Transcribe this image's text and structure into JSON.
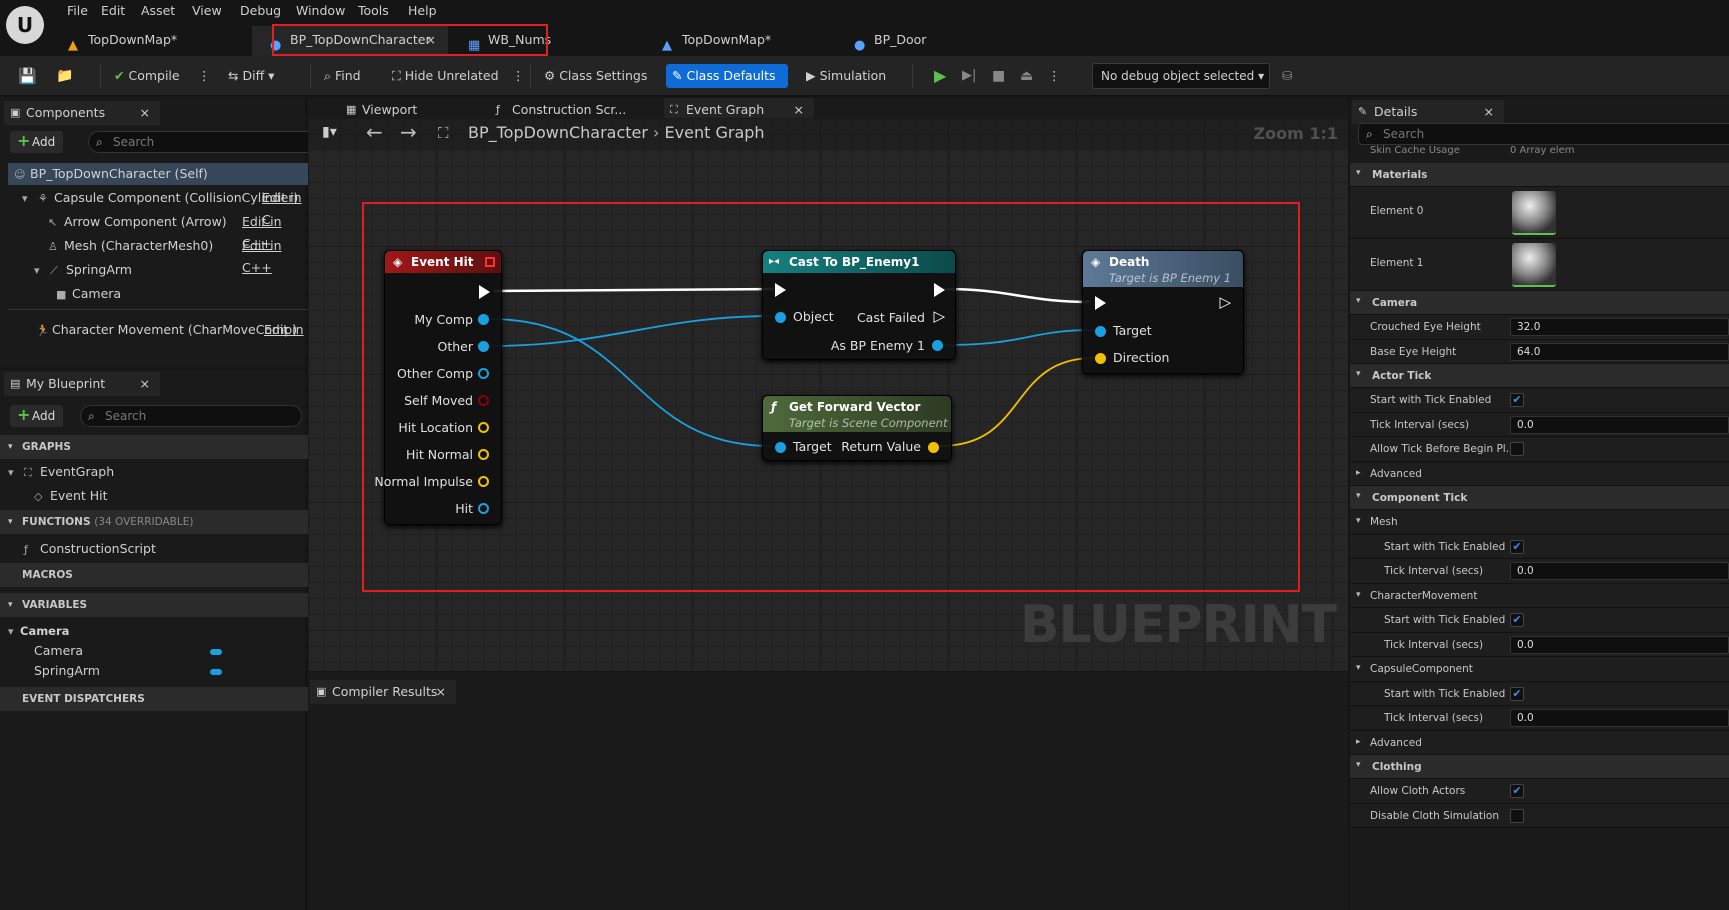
{
  "menu": [
    "File",
    "Edit",
    "Asset",
    "View",
    "Debug",
    "Window",
    "Tools",
    "Help"
  ],
  "tabs": [
    "TopDownMap*",
    "BP_TopDownCharacter",
    "WB_Nums",
    "TopDownMap*",
    "BP_Door"
  ],
  "toolbar": {
    "compile": "Compile",
    "diff": "Diff",
    "find": "Find",
    "hide_unrelated": "Hide Unrelated",
    "class_settings": "Class Settings",
    "class_defaults": "Class Defaults",
    "simulation": "Simulation",
    "debug_select": "No debug object selected"
  },
  "components": {
    "tab": "Components",
    "add": "Add",
    "search_placeholder": "Search",
    "items": [
      "BP_TopDownCharacter (Self)",
      "Capsule Component (CollisionCylinder)",
      "Arrow Component (Arrow)",
      "Mesh (CharacterMesh0)",
      "SpringArm",
      "Camera",
      "Character Movement (CharMoveComp)"
    ],
    "edit_in": "Edit in C",
    "edit_in_cpp": "Edit in C++",
    "edit_in_short": "Edit in"
  },
  "my_blueprint": {
    "tab": "My Blueprint",
    "add": "Add",
    "search_placeholder": "Search",
    "graphs": "GRAPHS",
    "event_graph": "EventGraph",
    "event_hit": "Event Hit",
    "functions": "FUNCTIONS",
    "functions_sub": "(34 OVERRIDABLE)",
    "construction_script": "ConstructionScript",
    "macros": "MACROS",
    "variables": "VARIABLES",
    "var_category": "Camera",
    "vars": [
      "Camera",
      "SpringArm"
    ],
    "event_dispatchers": "EVENT DISPATCHERS"
  },
  "graph_tabs": {
    "viewport": "Viewport",
    "construction": "Construction Scr...",
    "event_graph": "Event Graph"
  },
  "breadcrumb": {
    "bp": "BP_TopDownCharacter",
    "graph": "Event Graph",
    "zoom": "Zoom 1:1"
  },
  "watermark": "BLUEPRINT",
  "nodes": {
    "event_hit": {
      "title": "Event Hit",
      "pins": [
        "My Comp",
        "Other",
        "Other Comp",
        "Self Moved",
        "Hit Location",
        "Hit Normal",
        "Normal Impulse",
        "Hit"
      ]
    },
    "cast": {
      "title": "Cast To BP_Enemy1",
      "object": "Object",
      "cast_failed": "Cast Failed",
      "as": "As BP Enemy 1"
    },
    "death": {
      "title": "Death",
      "subtitle": "Target is BP Enemy 1",
      "target": "Target",
      "direction": "Direction"
    },
    "forward": {
      "title": "Get Forward Vector",
      "subtitle": "Target is Scene Component",
      "target": "Target",
      "ret": "Return Value"
    }
  },
  "compiler_results": "Compiler Results",
  "details": {
    "tab": "Details",
    "search_placeholder": "Search",
    "top_row_label": "Skin Cache Usage",
    "top_row_value": "0 Array elem",
    "rows": [
      {
        "type": "section",
        "label": "Materials"
      },
      {
        "type": "mat",
        "label": "Element 0"
      },
      {
        "type": "mat",
        "label": "Element 1"
      },
      {
        "type": "section",
        "label": "Camera"
      },
      {
        "type": "value",
        "label": "Crouched Eye Height",
        "value": "32.0"
      },
      {
        "type": "value",
        "label": "Base Eye Height",
        "value": "64.0"
      },
      {
        "type": "section",
        "label": "Actor Tick"
      },
      {
        "type": "check",
        "label": "Start with Tick Enabled",
        "checked": true
      },
      {
        "type": "value",
        "label": "Tick Interval (secs)",
        "value": "0.0"
      },
      {
        "type": "check",
        "label": "Allow Tick Before Begin Pl...",
        "checked": false
      },
      {
        "type": "collapsed",
        "label": "Advanced"
      },
      {
        "type": "section",
        "label": "Component Tick"
      },
      {
        "type": "subsection",
        "label": "Mesh"
      },
      {
        "type": "check2",
        "label": "Start with Tick Enabled",
        "checked": true
      },
      {
        "type": "value2",
        "label": "Tick Interval (secs)",
        "value": "0.0"
      },
      {
        "type": "subsection",
        "label": "CharacterMovement"
      },
      {
        "type": "check2",
        "label": "Start with Tick Enabled",
        "checked": true
      },
      {
        "type": "value2",
        "label": "Tick Interval (secs)",
        "value": "0.0"
      },
      {
        "type": "subsection",
        "label": "CapsuleComponent"
      },
      {
        "type": "check2",
        "label": "Start with Tick Enabled",
        "checked": true
      },
      {
        "type": "value2",
        "label": "Tick Interval (secs)",
        "value": "0.0"
      },
      {
        "type": "collapsed",
        "label": "Advanced"
      },
      {
        "type": "section",
        "label": "Clothing"
      },
      {
        "type": "check",
        "label": "Allow Cloth Actors",
        "checked": true
      },
      {
        "type": "check",
        "label": "Disable Cloth Simulation",
        "checked": false
      }
    ]
  },
  "colors": {
    "accent": "#0f6bd6",
    "highlight_box": "#e02020",
    "exec": "#ffffff",
    "object_pin": "#1aa0e0",
    "vector_pin": "#f2c200",
    "bool_pin": "#8b0000"
  }
}
